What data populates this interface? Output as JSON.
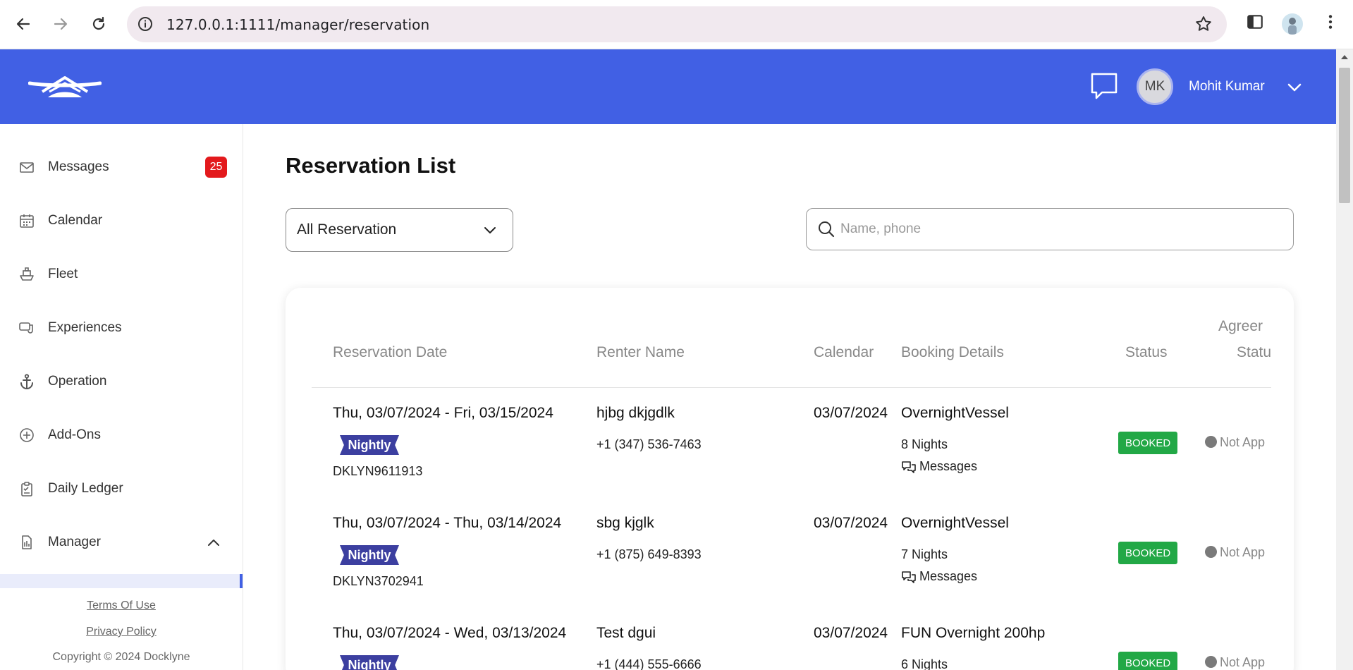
{
  "browser": {
    "url": "127.0.0.1:1111/manager/reservation"
  },
  "header": {
    "avatar_initials": "MK",
    "user_name": "Mohit Kumar"
  },
  "sidebar": {
    "items": [
      {
        "label": "Messages",
        "icon": "mail-icon",
        "badge": "25"
      },
      {
        "label": "Calendar",
        "icon": "calendar-icon"
      },
      {
        "label": "Fleet",
        "icon": "boat-icon"
      },
      {
        "label": "Experiences",
        "icon": "experience-icon"
      },
      {
        "label": "Operation",
        "icon": "anchor-icon"
      },
      {
        "label": "Add-Ons",
        "icon": "plus-circle-icon"
      },
      {
        "label": "Daily Ledger",
        "icon": "clipboard-icon"
      },
      {
        "label": "Manager",
        "icon": "document-icon"
      }
    ],
    "terms": "Terms Of Use",
    "privacy": "Privacy Policy",
    "copyright": "Copyright © 2024 Docklyne"
  },
  "main": {
    "title": "Reservation List",
    "filter": {
      "selected": "All Reservation"
    },
    "search": {
      "placeholder": "Name, phone",
      "value": ""
    },
    "columns": {
      "reservation_date": "Reservation Date",
      "renter_name": "Renter Name",
      "calendar": "Calendar",
      "booking_details": "Booking Details",
      "status": "Status",
      "agreement_line1": "Agreer",
      "agreement_line2": "Statu"
    },
    "rows": [
      {
        "date": "Thu, 03/07/2024 - Fri, 03/15/2024",
        "type": "Nightly",
        "code": "DKLYN9611913",
        "renter": "hjbg dkjgdlk",
        "phone": "+1 (347) 536-7463",
        "calendar": "03/07/2024",
        "vessel": "OvernightVessel",
        "nights": "8 Nights",
        "messages": "Messages",
        "status": "BOOKED",
        "agreement": "Not App"
      },
      {
        "date": "Thu, 03/07/2024 - Thu, 03/14/2024",
        "type": "Nightly",
        "code": "DKLYN3702941",
        "renter": "sbg kjglk",
        "phone": "+1 (875) 649-8393",
        "calendar": "03/07/2024",
        "vessel": "OvernightVessel",
        "nights": "7 Nights",
        "messages": "Messages",
        "status": "BOOKED",
        "agreement": "Not App"
      },
      {
        "date": "Thu, 03/07/2024 - Wed, 03/13/2024",
        "type": "Nightly",
        "code": "",
        "renter": "Test dgui",
        "phone": "+1 (444) 555-6666",
        "calendar": "03/07/2024",
        "vessel": "FUN Overnight 200hp",
        "nights": "6 Nights",
        "messages": "",
        "status": "BOOKED",
        "agreement": "Not App"
      }
    ]
  },
  "colors": {
    "header_blue": "#4160e4",
    "badge_red": "#e3191c",
    "booked_green": "#22a846",
    "nightly_purple": "#3c3fa0"
  }
}
